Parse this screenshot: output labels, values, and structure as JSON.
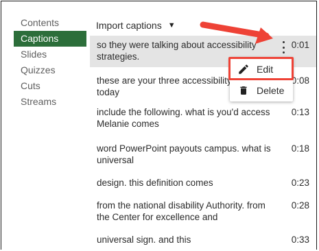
{
  "sidebar": {
    "items": [
      {
        "label": "Contents",
        "active": false
      },
      {
        "label": "Captions",
        "active": true
      },
      {
        "label": "Slides",
        "active": false
      },
      {
        "label": "Quizzes",
        "active": false
      },
      {
        "label": "Cuts",
        "active": false
      },
      {
        "label": "Streams",
        "active": false
      }
    ]
  },
  "toolbar": {
    "import_label": "Import captions",
    "import_caret": "▼"
  },
  "captions": [
    {
      "text": "so they were talking about accessibility strategies.",
      "time": "0:01"
    },
    {
      "text": "these are your three accessibility topics are today",
      "time": "0:08"
    },
    {
      "text": "include the following. what is you'd access Melanie comes",
      "time": "0:13"
    },
    {
      "text": "word PowerPoint payouts campus. what is universal",
      "time": "0:18"
    },
    {
      "text": "design. this definition comes",
      "time": "0:23"
    },
    {
      "text": "from the national disability Authority. from the Center for excellence and",
      "time": "0:28"
    },
    {
      "text": "universal sign. and this",
      "time": "0:33"
    }
  ],
  "context_menu": {
    "edit_label": "Edit",
    "delete_label": "Delete"
  },
  "colors": {
    "active_sidebar": "#2c6e3a",
    "annotation": "#ee4236",
    "selected_row": "#e4e4e4"
  },
  "icons": {
    "kebab": "kebab-menu-icon",
    "edit": "pencil-icon",
    "delete": "trash-icon",
    "dropdown": "caret-down-icon"
  }
}
